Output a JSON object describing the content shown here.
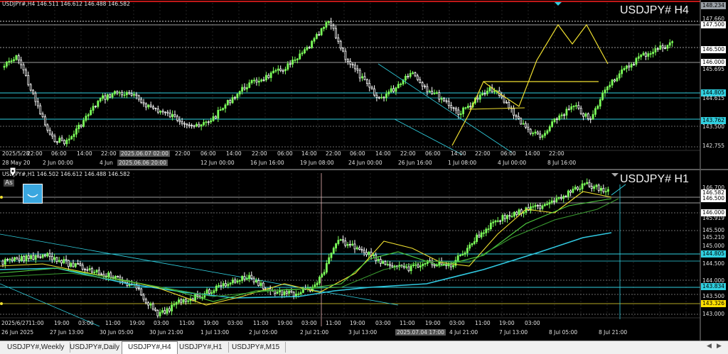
{
  "top": {
    "symbol_info": "USDJPY#,H4  146.511 146.612 146.488 146.582",
    "big_label": "USDJPY# H4",
    "price_labels": [
      {
        "text": "148.234",
        "bg": "#9aa0a6",
        "fg": "#000"
      },
      {
        "text": "147.660",
        "bg": "",
        "fg": "#e0e0e0"
      },
      {
        "text": "147.500",
        "bg": "#ffffff",
        "fg": "#000"
      },
      {
        "text": "146.500",
        "bg": "#ffffff",
        "fg": "#000"
      },
      {
        "text": "146.000",
        "bg": "#ffffff",
        "fg": "#000"
      },
      {
        "text": "145.695",
        "bg": "",
        "fg": "#e0e0e0"
      },
      {
        "text": "144.805",
        "bg": "#30d0e0",
        "fg": "#000"
      },
      {
        "text": "144.615",
        "bg": "",
        "fg": "#e0e0e0"
      },
      {
        "text": "143.762",
        "bg": "#30d0e0",
        "fg": "#000"
      },
      {
        "text": "143.500",
        "bg": "",
        "fg": "#e0e0e0"
      },
      {
        "text": "142.755",
        "bg": "",
        "fg": "#e0e0e0"
      }
    ],
    "time_labels": [
      "2025/5/28",
      "22:00",
      "06:00",
      "14:00",
      "22:00",
      "2025.06.07 02:00",
      "22:00",
      "06:00",
      "14:00",
      "22:00",
      "06:00",
      "14:00",
      "22:00",
      "06:00",
      "14:00",
      "22:00",
      "06:00",
      "14:00",
      "22:00",
      "06:00",
      "14:00",
      "22:00"
    ],
    "time_labels2": [
      "28 May 20",
      "2 Jun 00:00",
      "4 Jun",
      "2025.06.06 20:00",
      "12 Jun 00:00",
      "16 Jun 16:00",
      "19 Jun 08:00",
      "24 Jun 00:00",
      "26 Jun 16:00",
      "1 Jul 08:00",
      "4 Jul 00:00",
      "8 Jul 16:00"
    ]
  },
  "bottom": {
    "symbol_info": "USDJPY#,H1  146.502 146.612 146.488 146.582",
    "big_label": "USDJPY# H1",
    "as_label": "As",
    "price_labels": [
      {
        "text": "146.700",
        "bg": "",
        "fg": "#e0e0e0"
      },
      {
        "text": "146.582",
        "bg": "#ffffff",
        "fg": "#000"
      },
      {
        "text": "146.500",
        "bg": "#ffffff",
        "fg": "#000"
      },
      {
        "text": "146.000",
        "bg": "#ffffff",
        "fg": "#000"
      },
      {
        "text": "145.919",
        "bg": "",
        "fg": "#e0e0e0"
      },
      {
        "text": "145.500",
        "bg": "",
        "fg": "#e0e0e0"
      },
      {
        "text": "145.210",
        "bg": "",
        "fg": "#e0e0e0"
      },
      {
        "text": "145.000",
        "bg": "",
        "fg": "#e0e0e0"
      },
      {
        "text": "144.805",
        "bg": "#30d0e0",
        "fg": "#000"
      },
      {
        "text": "144.500",
        "bg": "",
        "fg": "#e0e0e0"
      },
      {
        "text": "144.000",
        "bg": "",
        "fg": "#e0e0e0"
      },
      {
        "text": "143.834",
        "bg": "#30d0e0",
        "fg": "#000"
      },
      {
        "text": "143.500",
        "bg": "",
        "fg": "#e0e0e0"
      },
      {
        "text": "143.326",
        "bg": "#ffe000",
        "fg": "#000"
      },
      {
        "text": "143.000",
        "bg": "",
        "fg": "#e0e0e0"
      }
    ],
    "time_labels": [
      "26 Jun 2025",
      "27 Jun 13:00",
      "30 Jun 05:00",
      "30 Jun 21:00",
      "1 Jul 13:00",
      "2 Jul 05:00",
      "2 Jul 21:00",
      "3 Jul 13:00",
      "2025.07.04 17:00",
      "4 Jul 21:00",
      "7 Jul 13:00",
      "8 Jul 05:00",
      "8 Jul 21:00"
    ],
    "time_labels2": [
      "2025/6/27",
      "11:00",
      "19:00",
      "03:00",
      "11:00",
      "19:00",
      "03:00",
      "11:00",
      "19:00",
      "03:00",
      "11:00",
      "19:00",
      "03:00",
      "11:00",
      "19:00",
      "03:00",
      "11:00",
      "19:00",
      "03:00",
      "11:00",
      "19:00",
      "03:00"
    ],
    "selected_time": "2025.07.04 17:00"
  },
  "tabs": [
    {
      "label": "USDJPY#,Weekly",
      "active": false
    },
    {
      "label": "USDJPY#,Daily",
      "active": false
    },
    {
      "label": "USDJPY#,H4",
      "active": true
    },
    {
      "label": "USDJPY#,H1",
      "active": false
    },
    {
      "label": "USDJPY#,M15",
      "active": false
    }
  ],
  "colors": {
    "bull": "#7cff5a",
    "bear": "#ffffff",
    "ma_yellow": "#f0e030",
    "ma_green": "#50d040",
    "ma_cyan": "#30c8e0",
    "hline_cyan": "#30d0e0",
    "hline_white": "#d0d0d0",
    "red_line": "#ff2020"
  }
}
